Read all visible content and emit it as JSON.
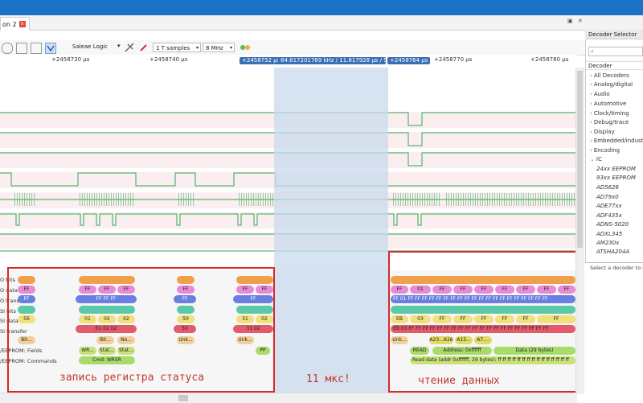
{
  "tab": {
    "title": "on 2"
  },
  "decoder_panel": {
    "title": "Decoder Selector",
    "search_placeholder": "",
    "column_header": "Decoder",
    "categories": [
      "All Decoders",
      "Analog/digital",
      "Audio",
      "Automotive",
      "Clock/timing",
      "Debug/trace",
      "Display",
      "Embedded/industr",
      "Encoding",
      "IC"
    ],
    "ic_items": [
      "24xx EEPROM",
      "93xx EEPROM",
      "AD5626",
      "AD79x0",
      "ADE77xx",
      "ADF435x",
      "ADNS-5020",
      "ADXL345",
      "AM230x",
      "ATSHA204A"
    ],
    "hint": "Select a decoder to s"
  },
  "toolbar": {
    "device": "Saleae Logic",
    "samples": "1 T samples",
    "rate": "8 MHz"
  },
  "time_axis": {
    "ticks": [
      "+2458730 µs",
      "+2458740 µs",
      "+2458770 µs",
      "+2458780 µs"
    ],
    "marker_left": "+2458752 µs",
    "marker_mid": "84.617201769 kHz / 11.817928 µs / 94",
    "marker_right": "+2458764 µs"
  },
  "row_labels": [
    "O bits",
    "O data",
    "O transfer",
    "SI bits",
    "SI data",
    "SI transfer",
    "/EEPROM: Fields",
    "/EEPROM: Commands"
  ],
  "left_decode": {
    "mosi_data": [
      "FF",
      "FF",
      "FF",
      "FF",
      "FF",
      "FF",
      "FF"
    ],
    "mosi_transfer": [
      "FF",
      "FF FF FF",
      "FF",
      "FF"
    ],
    "miso_data": [
      "56",
      "01",
      "02",
      "02",
      "50",
      "31",
      "02"
    ],
    "miso_transfer": [
      "01 02 02",
      "50",
      "31 02"
    ],
    "fields": [
      "Bit...",
      "WR...",
      "Bit...",
      "No...",
      "Unk...",
      "Unk...",
      "Stat...",
      "Stat..."
    ],
    "commands": [
      "Cmd: WRSR",
      "PP"
    ]
  },
  "right_decode": {
    "mosi_data": [
      "FF",
      "01",
      "FF",
      "FF",
      "FF",
      "FF",
      "FF",
      "FF",
      "FF",
      "FF"
    ],
    "mosi_transfer": "FF 01 FF FF FF FF FF FF FF FF FF FF FF FF FF FF FF FF FF FF FF FF",
    "miso_data": [
      "EB",
      "03",
      "FF",
      "FF",
      "FF",
      "FF",
      "FF",
      "FF"
    ],
    "miso_transfer": "EB 03 FF FF FF FF FF FF FF FF FF FF FF FF FF FF FF FF FF FF FF FF",
    "fields": [
      "Unk...",
      "A23...A16",
      "A15...",
      "A7...."
    ],
    "read_label": "READ",
    "address": "Address: 0xffffff",
    "data": "Data (29 bytes)",
    "command": "Read data (addr 0xffffff, 29 bytes): ff ff ff ff ff ff ff ff ff ff ff ff ff ff ff"
  },
  "annotations": {
    "left": "запись регистра статуса",
    "middle": "11 мкс!",
    "right": "чтение данных"
  },
  "colors": {
    "title_bar": "#1a73c6",
    "wave_green": "#2fa84f",
    "selection": "#c9d9ec",
    "red_box": "#d62828",
    "pill_orange": "#f0a04a",
    "pill_pink": "#e98ad6",
    "pill_blue": "#6a7fe0",
    "pill_teal": "#5bc8a8",
    "pill_yellow": "#f2e07a",
    "pill_red": "#e25b6b",
    "pill_green": "#a8dc6a"
  }
}
